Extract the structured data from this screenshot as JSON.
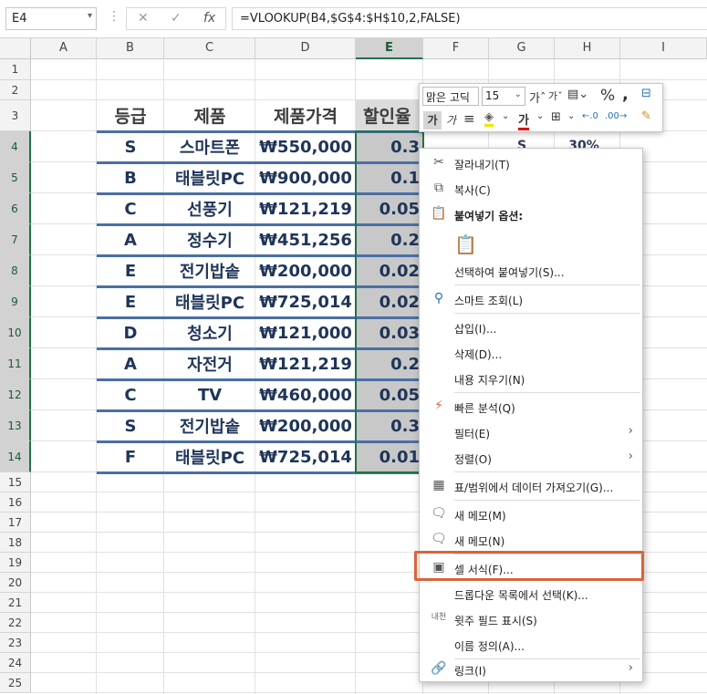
{
  "formula_bar": {
    "name_box": "E4",
    "cancel_icon": "✕",
    "enter_icon": "✓",
    "fx_label": "fx",
    "formula": "=VLOOKUP(B4,$G$4:$H$10,2,FALSE)"
  },
  "columns": [
    "A",
    "B",
    "C",
    "D",
    "E",
    "F",
    "G",
    "H",
    "I"
  ],
  "rows": [
    "1",
    "2",
    "3",
    "4",
    "5",
    "6",
    "7",
    "8",
    "9",
    "10",
    "11",
    "12",
    "13",
    "14",
    "15",
    "16",
    "17",
    "18",
    "19",
    "20",
    "21",
    "22",
    "23",
    "24",
    "25"
  ],
  "table": {
    "headers": [
      "등급",
      "제품",
      "제품가격",
      "할인율"
    ],
    "data": [
      [
        "S",
        "스마트폰",
        "₩550,000",
        "0.3"
      ],
      [
        "B",
        "태블릿PC",
        "₩900,000",
        "0.1"
      ],
      [
        "C",
        "선풍기",
        "₩121,219",
        "0.05"
      ],
      [
        "A",
        "정수기",
        "₩451,256",
        "0.2"
      ],
      [
        "E",
        "전기밥솥",
        "₩200,000",
        "0.02"
      ],
      [
        "E",
        "태블릿PC",
        "₩725,014",
        "0.02"
      ],
      [
        "D",
        "청소기",
        "₩121,000",
        "0.03"
      ],
      [
        "A",
        "자전거",
        "₩121,219",
        "0.2"
      ],
      [
        "C",
        "TV",
        "₩460,000",
        "0.05"
      ],
      [
        "S",
        "전기밥솥",
        "₩200,000",
        "0.3"
      ],
      [
        "F",
        "태블릿PC",
        "₩725,014",
        "0.01"
      ]
    ]
  },
  "lookup_partial": {
    "g4": "S",
    "h4": "30%"
  },
  "mini_toolbar": {
    "font_name": "맑은 고딕",
    "font_size": "15",
    "bold_label": "가",
    "italic_label": "가",
    "font_color_label": "가"
  },
  "context_menu": {
    "cut": "잘라내기(T)",
    "copy": "복사(C)",
    "paste_options": "붙여넣기 옵션:",
    "paste_special": "선택하여 붙여넣기(S)...",
    "smart_lookup": "스마트 조회(L)",
    "insert": "삽입(I)...",
    "delete": "삭제(D)...",
    "clear_contents": "내용 지우기(N)",
    "quick_analysis": "빠른 분석(Q)",
    "filter": "필터(E)",
    "sort": "정렬(O)",
    "get_data": "표/범위에서 데이터 가져오기(G)...",
    "new_comment": "새 메모(M)",
    "new_note": "새 메모(N)",
    "format_cells": "셀 서식(F)...",
    "dropdown_pick": "드롭다운 목록에서 선택(K)...",
    "phonetic": "윗주 필드 표시(S)",
    "define_name": "이름 정의(A)...",
    "link": "링크(I)",
    "phonetic_icon_text": "내천"
  },
  "colors": {
    "accent_green": "#217346",
    "highlight": "#d9643a",
    "table_line": "#4a6fa5"
  }
}
